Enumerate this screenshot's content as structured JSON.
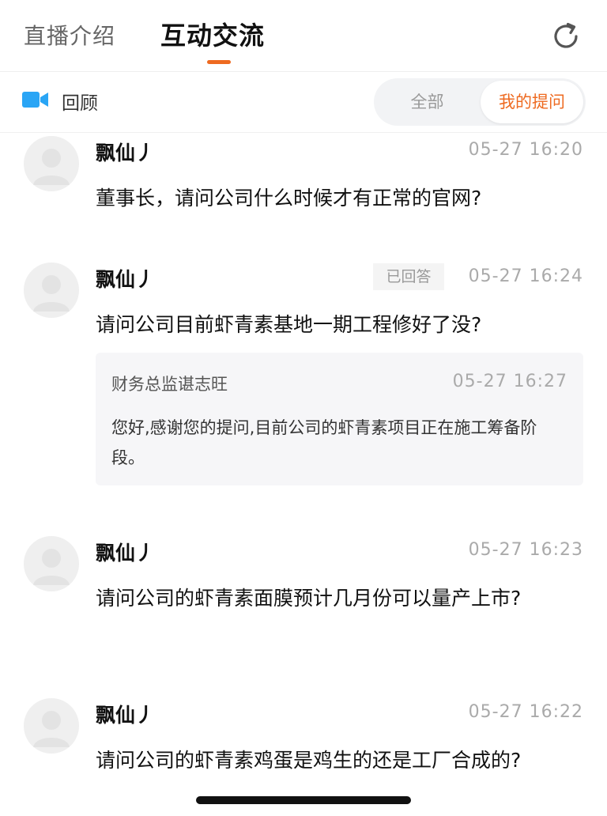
{
  "header": {
    "tabs": [
      {
        "label": "直播介绍"
      },
      {
        "label": "互动交流"
      }
    ],
    "icons": {
      "refresh": "refresh-icon"
    }
  },
  "subbar": {
    "review_label": "回顾",
    "filter": {
      "all_label": "全部",
      "mine_label": "我的提问",
      "selected": "我的提问"
    },
    "icons": {
      "video": "video-camera-icon"
    }
  },
  "colors": {
    "accent": "#ee6a20",
    "video_icon": "#2aa5f5"
  },
  "posts": [
    {
      "user": "飘仙丿",
      "time": "05-27 16:20",
      "question": "董事长，请问公司什么时候才有正常的官网?"
    },
    {
      "user": "飘仙丿",
      "time": "05-27 16:24",
      "badge": "已回答",
      "question": "请问公司目前虾青素基地一期工程修好了没?",
      "reply": {
        "name": "财务总监谌志旺",
        "time": "05-27 16:27",
        "text": "您好,感谢您的提问,目前公司的虾青素项目正在施工筹备阶段。"
      }
    },
    {
      "user": "飘仙丿",
      "time": "05-27 16:23",
      "question": "请问公司的虾青素面膜预计几月份可以量产上市?"
    },
    {
      "user": "飘仙丿",
      "time": "05-27 16:22",
      "question": "请问公司的虾青素鸡蛋是鸡生的还是工厂合成的?"
    }
  ]
}
